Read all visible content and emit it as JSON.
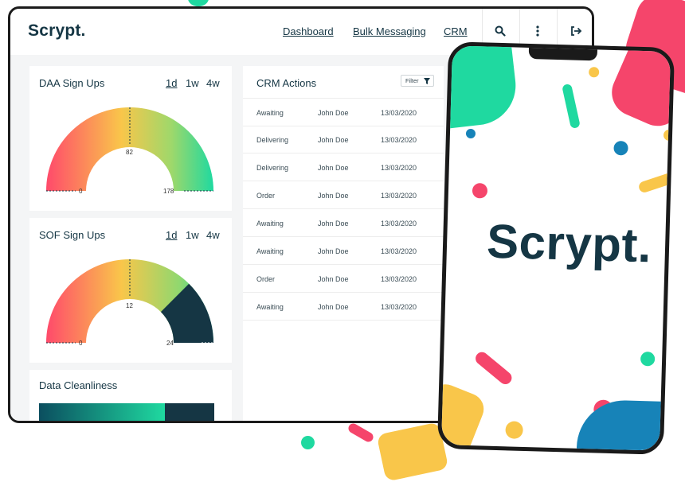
{
  "header": {
    "brand": "Scrypt.",
    "nav": [
      "Dashboard",
      "Bulk Messaging",
      "CRM"
    ],
    "icons": [
      "search-icon",
      "more-vertical-icon",
      "logout-icon"
    ]
  },
  "daa": {
    "title": "DAA Sign Ups",
    "ranges": [
      "1d",
      "1w",
      "4w"
    ],
    "active_range": "1d",
    "gauge": {
      "min": "0",
      "max": "178",
      "value": "82"
    }
  },
  "sof": {
    "title": "SOF Sign Ups",
    "ranges": [
      "1d",
      "1w",
      "4w"
    ],
    "active_range": "1d",
    "gauge": {
      "min": "0",
      "max": "24",
      "value": "12"
    }
  },
  "cleanliness": {
    "title": "Data Cleanliness"
  },
  "crm": {
    "title": "CRM Actions",
    "filter_label": "Filter",
    "rows": [
      {
        "status": "Awaiting",
        "name": "John Doe",
        "date": "13/03/2020"
      },
      {
        "status": "Delivering",
        "name": "John Doe",
        "date": "13/03/2020"
      },
      {
        "status": "Delivering",
        "name": "John Doe",
        "date": "13/03/2020"
      },
      {
        "status": "Order",
        "name": "John Doe",
        "date": "13/03/2020"
      },
      {
        "status": "Awaiting",
        "name": "John Doe",
        "date": "13/03/2020"
      },
      {
        "status": "Awaiting",
        "name": "John Doe",
        "date": "13/03/2020"
      },
      {
        "status": "Order",
        "name": "John Doe",
        "date": "13/03/2020"
      },
      {
        "status": "Awaiting",
        "name": "John Doe",
        "date": "13/03/2020"
      }
    ]
  },
  "phone": {
    "logo": "Scrypt."
  },
  "colors": {
    "navy": "#153644",
    "red": "#f5456b",
    "yellow": "#f9c64a",
    "green": "#1fd9a0",
    "blue": "#1783b8"
  }
}
